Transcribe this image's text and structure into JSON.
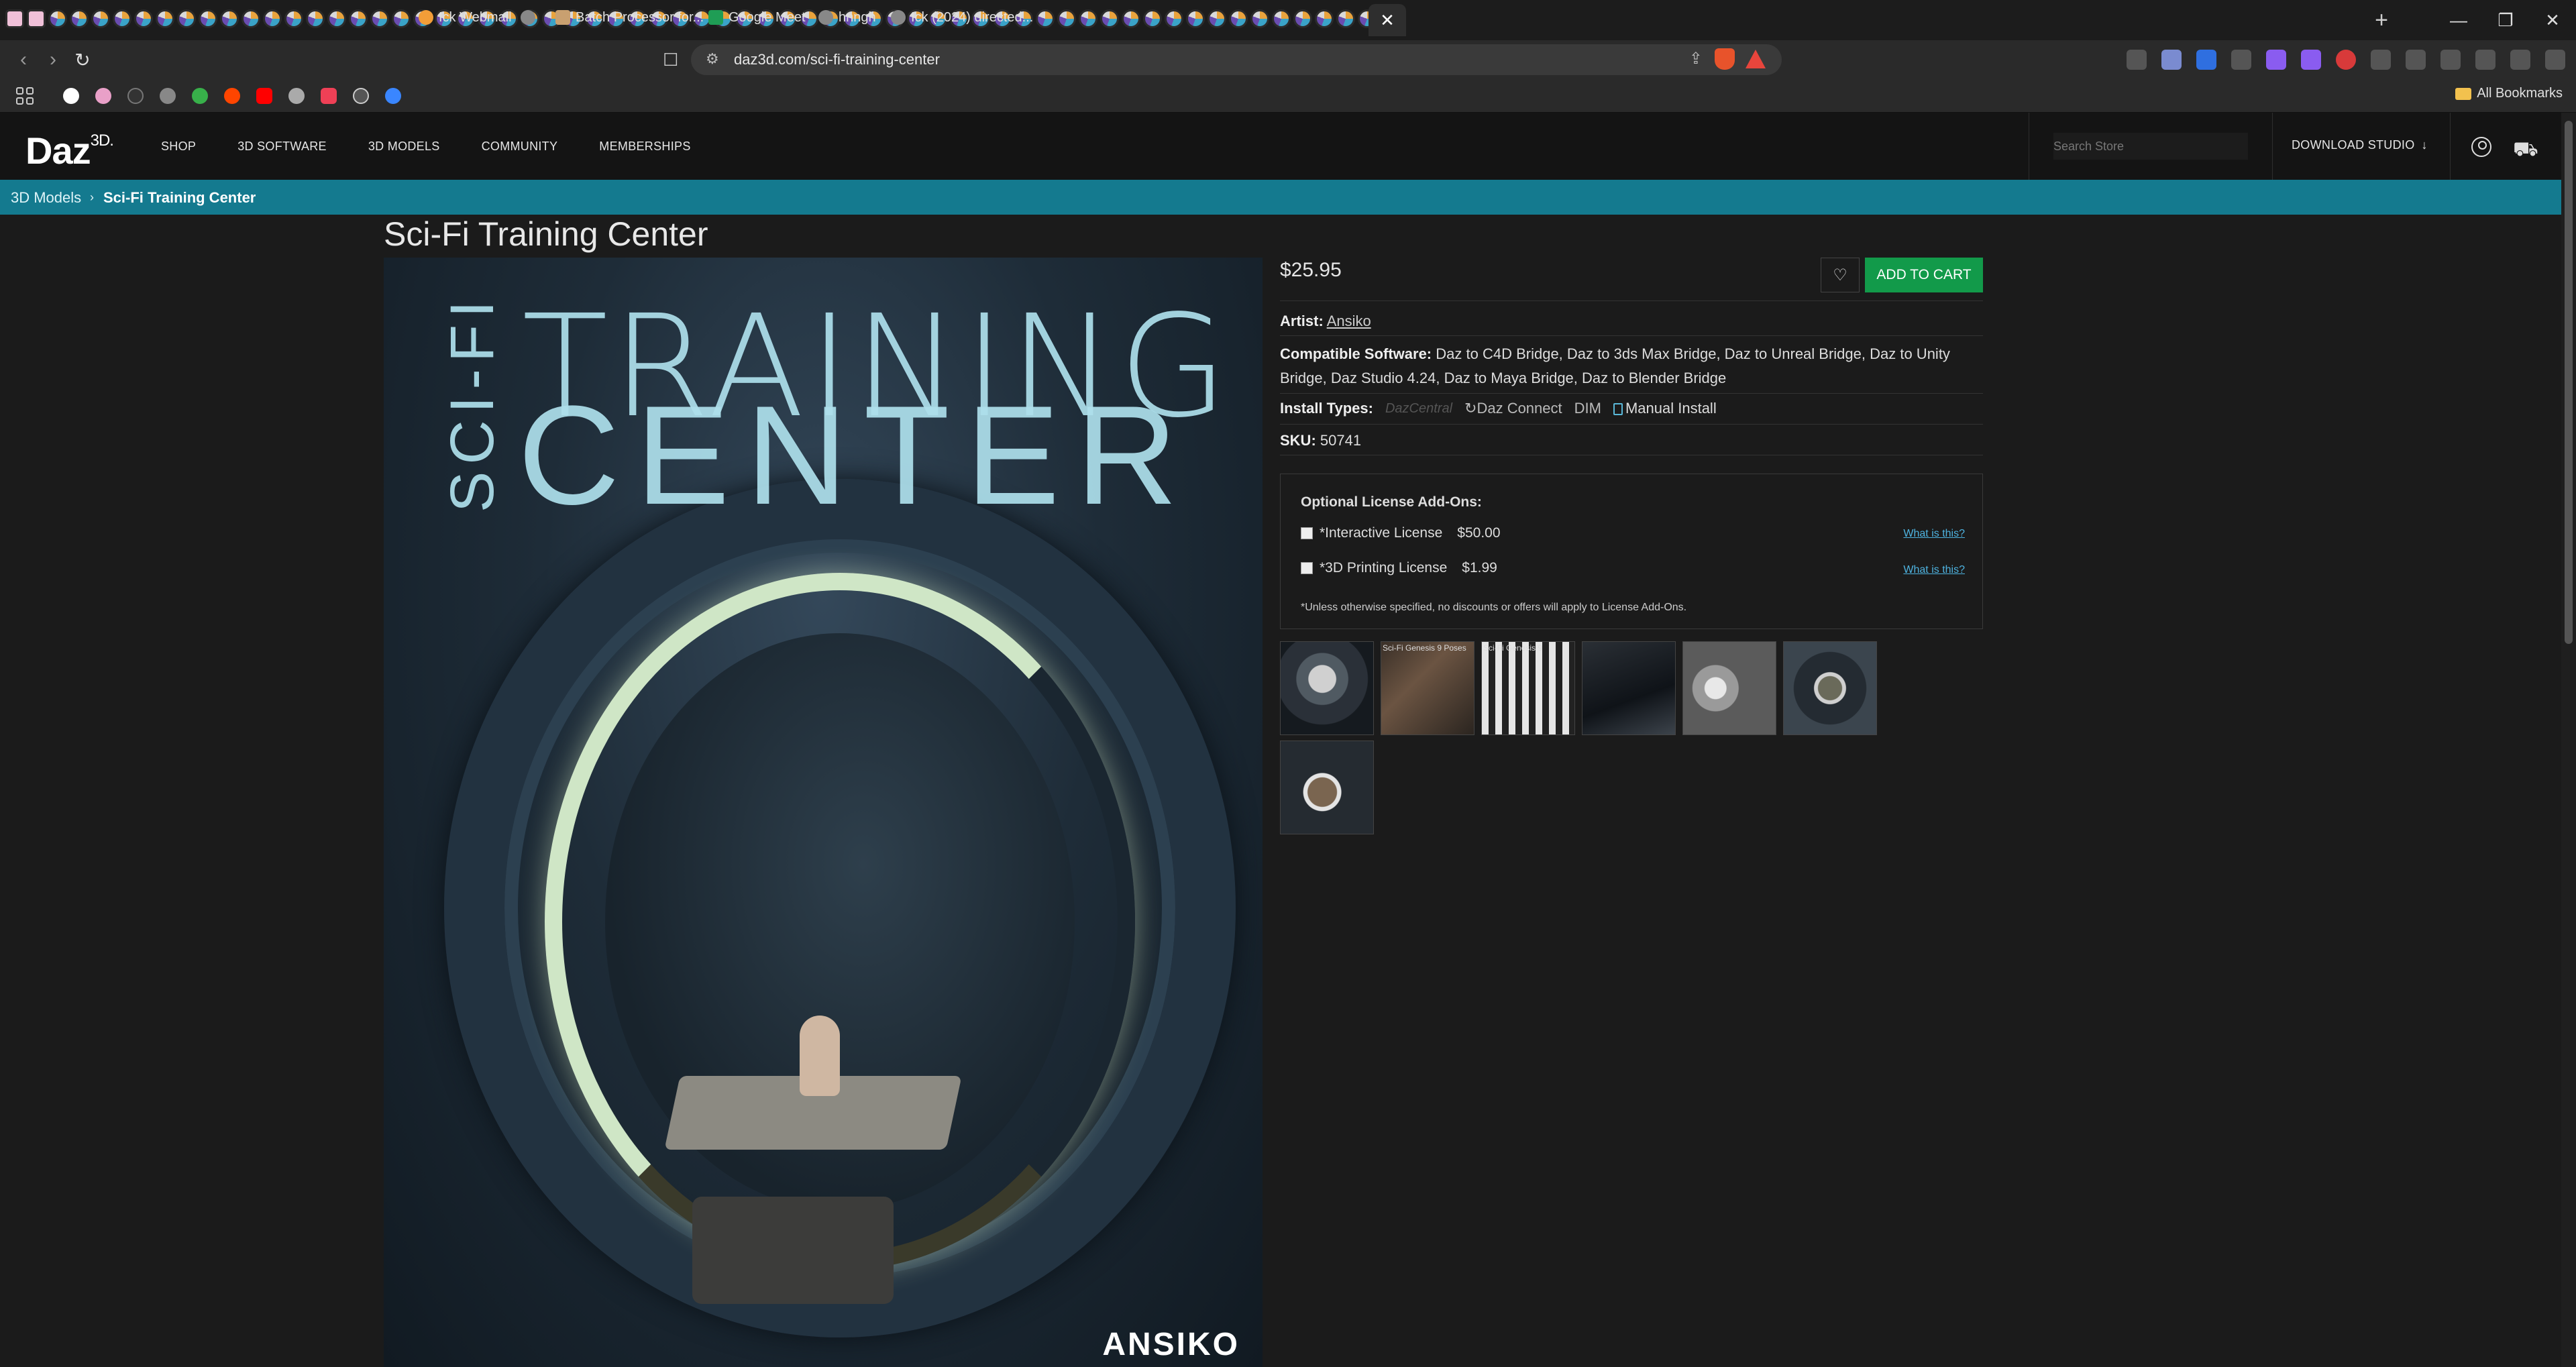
{
  "browser": {
    "url": "daz3d.com/sci-fi-training-center",
    "bookmarks": [
      {
        "label": "Ick Webmail"
      },
      {
        "label": "Batch Processor for..."
      },
      {
        "label": "Google Meet"
      },
      {
        "label": "hnngh"
      },
      {
        "label": "Ick (2024) directed..."
      }
    ],
    "all_bookmarks": "All Bookmarks"
  },
  "site": {
    "logo": "Daz",
    "logo_sup": "3D.",
    "nav": [
      "SHOP",
      "3D SOFTWARE",
      "3D MODELS",
      "COMMUNITY",
      "MEMBERSHIPS"
    ],
    "search_placeholder": "Search Store",
    "download_studio": "DOWNLOAD STUDIO"
  },
  "breadcrumb": {
    "parent": "3D Models",
    "separator": "›",
    "current": "Sci-Fi Training Center"
  },
  "product": {
    "title": "Sci-Fi Training Center",
    "price": "$25.95",
    "add_to_cart": "ADD TO CART",
    "artist_label": "Artist:",
    "artist": "Ansiko",
    "compat_label": "Compatible Software:",
    "compat": "Daz to C4D Bridge, Daz to 3ds Max Bridge, Daz to Unreal Bridge, Daz to Unity Bridge, Daz Studio 4.24, Daz to Maya Bridge, Daz to Blender Bridge",
    "install_label": "Install Types:",
    "install_types": [
      "DazCentral",
      "Daz Connect",
      "DIM",
      "Manual Install"
    ],
    "sku_label": "SKU:",
    "sku": "50741",
    "hero_text": {
      "line1": "TRAINING",
      "line2": "CENTER",
      "vertical": "SCI-FI",
      "signature": "ANSIKO"
    }
  },
  "licenses": {
    "title": "Optional License Add-Ons:",
    "items": [
      {
        "name": "*Interactive License",
        "price": "$50.00",
        "link": "What is this?"
      },
      {
        "name": "*3D Printing License",
        "price": "$1.99",
        "link": "What is this?"
      }
    ],
    "note": "*Unless otherwise specified, no discounts or offers will apply to License Add-Ons."
  },
  "thumbnails": [
    {
      "name": "thumb-1",
      "caption": ""
    },
    {
      "name": "thumb-2",
      "caption": "Sci-Fi Genesis 9 Poses"
    },
    {
      "name": "thumb-3",
      "caption": "Sci-Fi Genesis 9"
    },
    {
      "name": "thumb-4",
      "caption": ""
    },
    {
      "name": "thumb-5",
      "caption": ""
    },
    {
      "name": "thumb-6",
      "caption": ""
    },
    {
      "name": "thumb-7",
      "caption": ""
    }
  ],
  "colors": {
    "breadcrumb_bg": "#147a8f",
    "cart_button": "#129a4a",
    "link": "#4eb3e0"
  }
}
